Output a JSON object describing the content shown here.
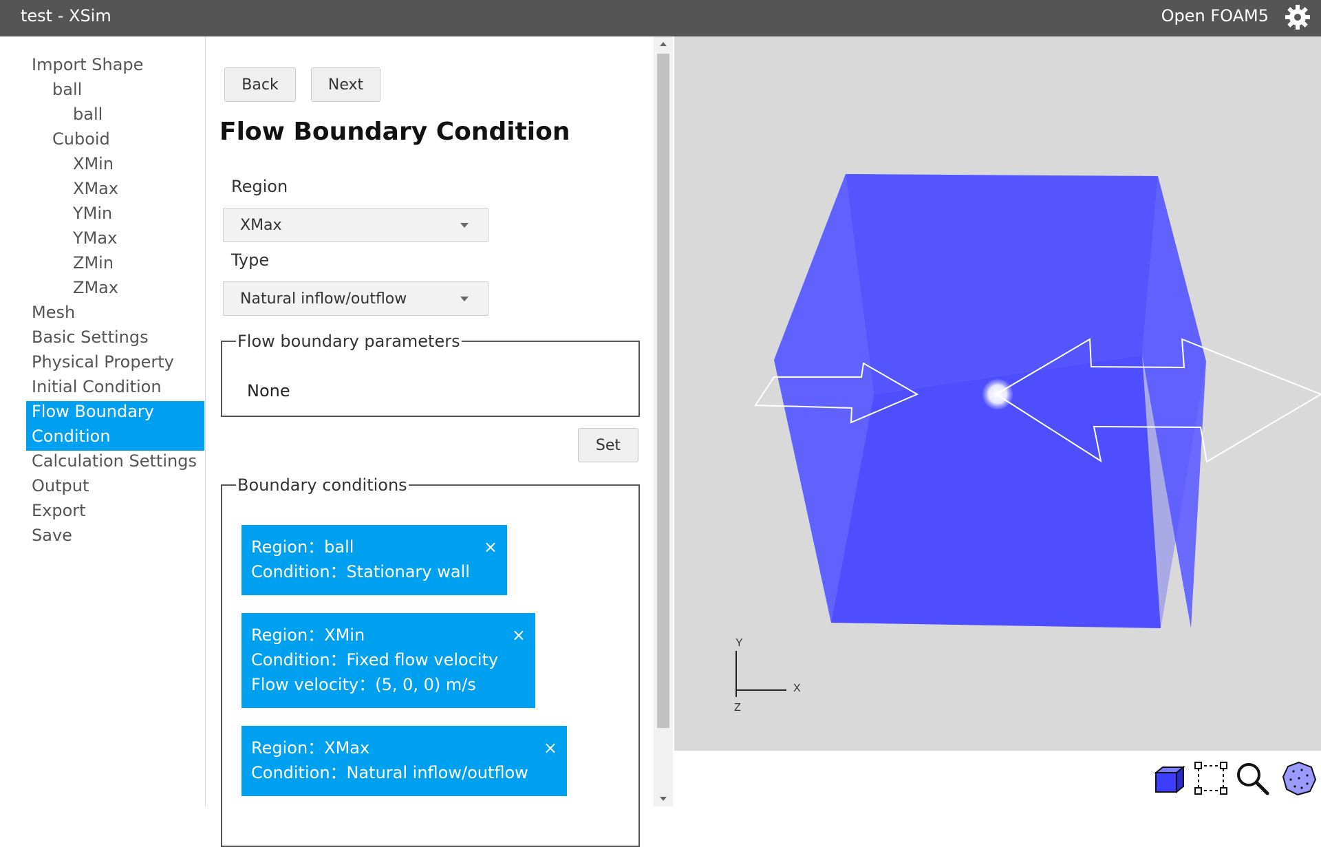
{
  "titlebar": {
    "app_title": "test - XSim",
    "solver": "Open FOAM5",
    "settings_icon": "gear-icon"
  },
  "sidebar": {
    "import_shape": "Import Shape",
    "ball_group": "ball",
    "ball_face": "ball",
    "cuboid_group": "Cuboid",
    "xmin": "XMin",
    "xmax": "XMax",
    "ymin": "YMin",
    "ymax": "YMax",
    "zmin": "ZMin",
    "zmax": "ZMax",
    "mesh": "Mesh",
    "basic_settings": "Basic Settings",
    "physical_property": "Physical Property",
    "initial_condition": "Initial Condition",
    "flow_boundary_line1": "Flow Boundary",
    "flow_boundary_line2": "Condition",
    "calculation_settings": "Calculation Settings",
    "output": "Output",
    "export": "Export",
    "save": "Save"
  },
  "form": {
    "back_label": "Back",
    "next_label": "Next",
    "heading": "Flow Boundary Condition",
    "region_label": "Region",
    "region_value": "XMax",
    "type_label": "Type",
    "type_value": "Natural inflow/outflow",
    "params_legend": "Flow boundary parameters",
    "params_value": "None",
    "set_label": "Set",
    "conditions_legend": "Boundary conditions",
    "conditions": [
      {
        "line1": "Region：ball",
        "line2": "Condition：Stationary wall",
        "line3": ""
      },
      {
        "line1": "Region：XMin",
        "line2": "Condition：Fixed flow velocity",
        "line3": "Flow velocity：(5, 0, 0) m/s"
      },
      {
        "line1": "Region：XMax",
        "line2": "Condition：Natural inflow/outflow",
        "line3": ""
      }
    ],
    "remove_glyph": "×"
  },
  "viewport": {
    "axis_x": "X",
    "axis_y": "Y",
    "axis_z": "Z",
    "cube_color": "#4a4aff",
    "background": "#d9d9d9"
  },
  "toolbar": {
    "tools": [
      "cube-view-icon",
      "box-select-icon",
      "zoom-icon",
      "mesh-sphere-icon"
    ]
  }
}
